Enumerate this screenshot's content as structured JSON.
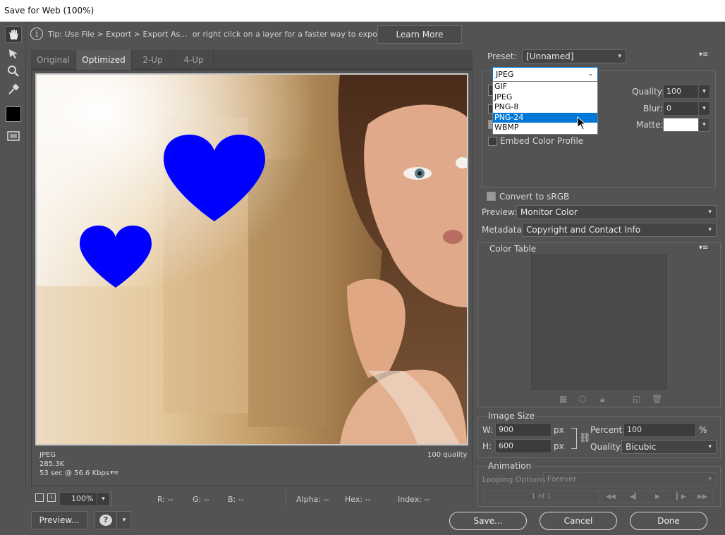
{
  "window": {
    "title": "Save for Web (100%)"
  },
  "tip": {
    "text": "Tip: Use File > Export > Export As...  or right click on a layer for a faster way to export assets",
    "learn_more": "Learn More"
  },
  "tabs": [
    "Original",
    "Optimized",
    "2-Up",
    "4-Up"
  ],
  "image_status": {
    "format": "JPEG",
    "size": "285.3K",
    "time": "53 sec @ 56.6 Kbps",
    "quality": "100 quality"
  },
  "bottom_bar": {
    "zoom": "100%",
    "r": "R: --",
    "g": "G: --",
    "b": "B: --",
    "alpha": "Alpha: --",
    "hex": "Hex: --",
    "index": "Index: --"
  },
  "buttons": {
    "preview": "Preview...",
    "save": "Save...",
    "cancel": "Cancel",
    "done": "Done"
  },
  "preset": {
    "label": "Preset:",
    "value": "[Unnamed]"
  },
  "format": {
    "selected": "JPEG",
    "options": [
      "GIF",
      "JPEG",
      "PNG-8",
      "PNG-24",
      "WBMP"
    ],
    "highlighted": "PNG-24"
  },
  "quality": {
    "label": "Quality:",
    "value": "100"
  },
  "blur": {
    "label": "Blur:",
    "value": "0"
  },
  "matte": {
    "label": "Matte:"
  },
  "embed_color_profile": {
    "label": "Embed Color Profile",
    "checked": false
  },
  "convert_srgb": {
    "label": "Convert to sRGB",
    "checked": true
  },
  "preview_setting": {
    "label": "Preview:",
    "value": "Monitor Color"
  },
  "metadata": {
    "label": "Metadata:",
    "value": "Copyright and Contact Info"
  },
  "color_table": {
    "title": "Color Table"
  },
  "image_size": {
    "title": "Image Size",
    "w_label": "W:",
    "w_value": "900",
    "h_label": "H:",
    "h_value": "600",
    "unit": "px",
    "percent_label": "Percent:",
    "percent_value": "100",
    "percent_unit": "%",
    "quality_label": "Quality:",
    "quality_value": "Bicubic"
  },
  "animation": {
    "title": "Animation",
    "looping_label": "Looping Options:",
    "looping_value": "Forever",
    "frame": "1 of 1"
  },
  "colors": {
    "heart": "#0000ff",
    "highlight": "#0078d7"
  }
}
